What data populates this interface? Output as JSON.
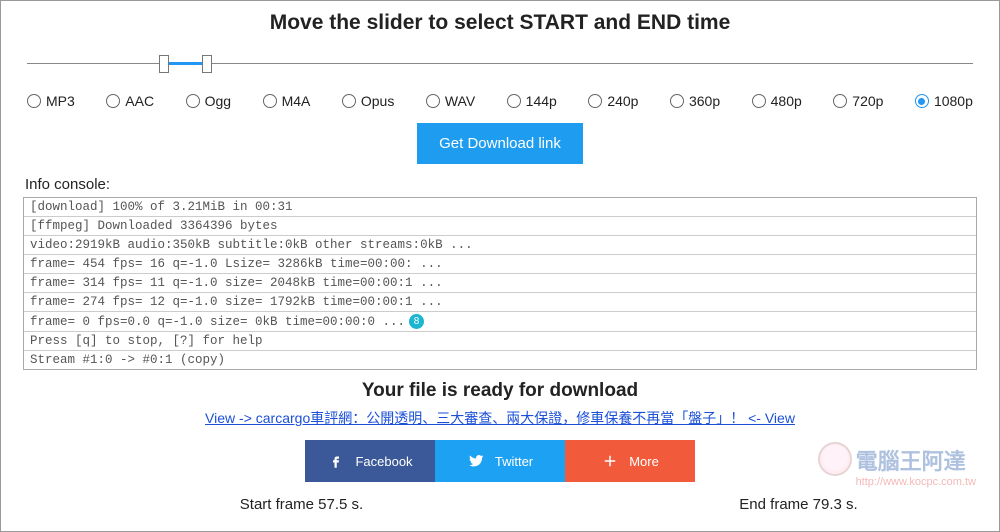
{
  "title": "Move the slider to select START and END time",
  "slider": {
    "start_pct": 14.5,
    "end_pct": 19.0
  },
  "formats": [
    {
      "label": "MP3",
      "selected": false
    },
    {
      "label": "AAC",
      "selected": false
    },
    {
      "label": "Ogg",
      "selected": false
    },
    {
      "label": "M4A",
      "selected": false
    },
    {
      "label": "Opus",
      "selected": false
    },
    {
      "label": "WAV",
      "selected": false
    },
    {
      "label": "144p",
      "selected": false
    },
    {
      "label": "240p",
      "selected": false
    },
    {
      "label": "360p",
      "selected": false
    },
    {
      "label": "480p",
      "selected": false
    },
    {
      "label": "720p",
      "selected": false
    },
    {
      "label": "1080p",
      "selected": true
    }
  ],
  "download_button": "Get Download link",
  "console_label": "Info console:",
  "console_lines": [
    "[download] 100% of 3.21MiB in 00:31",
    "[ffmpeg] Downloaded 3364396 bytes",
    "video:2919kB audio:350kB subtitle:0kB other streams:0kB ...",
    "frame= 454 fps= 16 q=-1.0 Lsize= 3286kB time=00:00: ...",
    "frame= 314 fps= 11 q=-1.0 size= 2048kB time=00:00:1 ...",
    "frame= 274 fps= 12 q=-1.0 size= 1792kB time=00:00:1 ...",
    "frame= 0 fps=0.0 q=-1.0 size= 0kB time=00:00:0 ...",
    "Press [q] to stop, [?] for help",
    "Stream #1:0 -> #0:1 (copy)"
  ],
  "console_badge": {
    "line_index": 6,
    "text": "8"
  },
  "ready_title": "Your file is ready for download",
  "promo_link": "View -> carcargo車評網：公開透明、三大審查、兩大保證，修車保養不再當「盤子」！ <- View",
  "share": {
    "facebook": "Facebook",
    "twitter": "Twitter",
    "more": "More"
  },
  "frames": {
    "start": "Start frame 57.5 s.",
    "end": "End frame 79.3 s."
  },
  "watermark": {
    "main": "電腦王阿達",
    "sub": "http://www.kocpc.com.tw"
  }
}
